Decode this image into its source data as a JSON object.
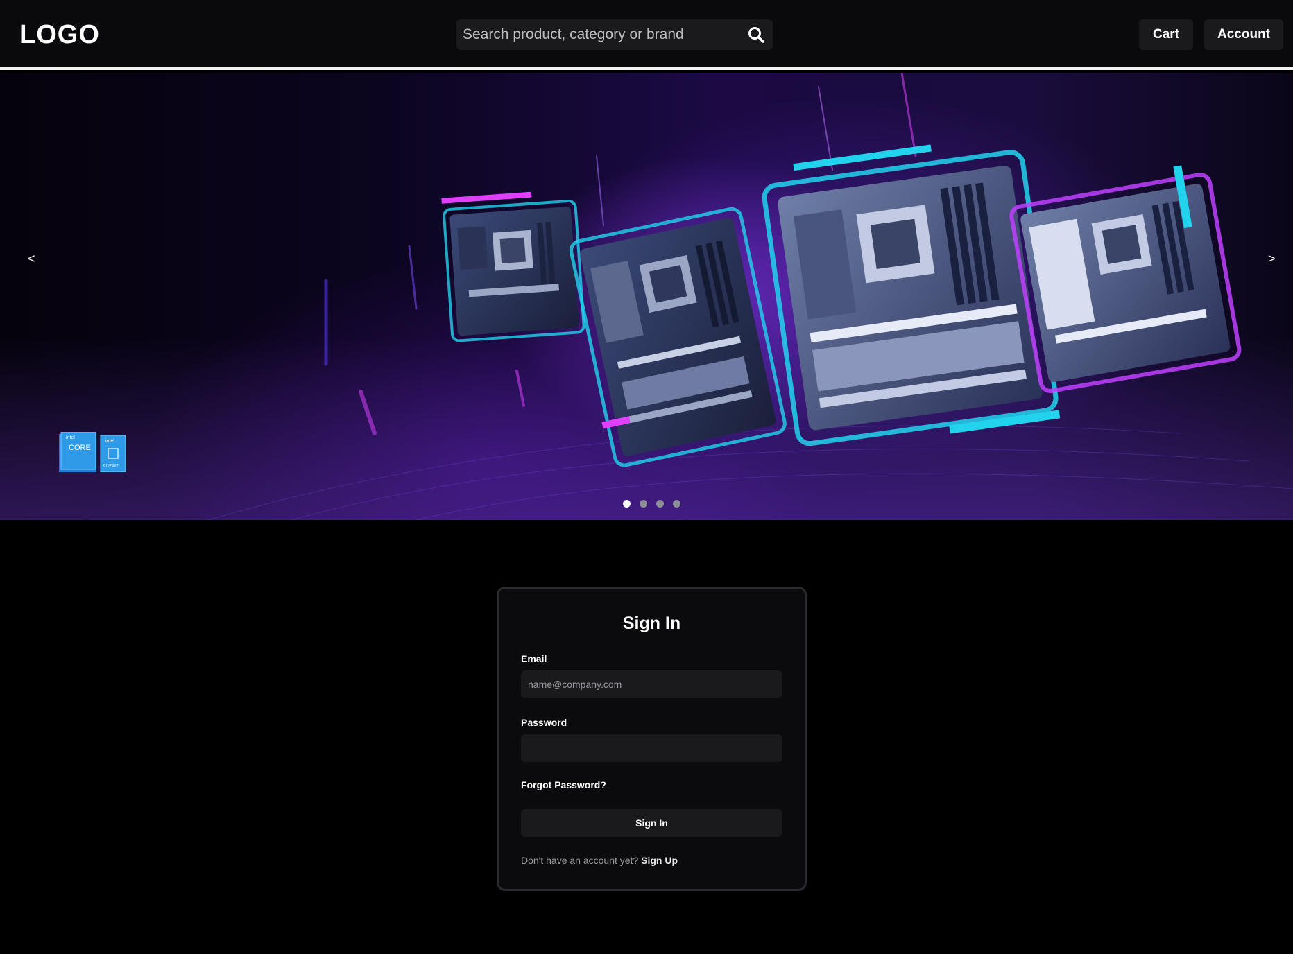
{
  "header": {
    "logo": "LOGO",
    "search_placeholder": "Search product, category or brand",
    "cart_label": "Cart",
    "account_label": "Account"
  },
  "hero": {
    "prev_label": "<",
    "next_label": ">",
    "slide_count": 4,
    "active_slide": 1,
    "badge_text": [
      "intel",
      "CORE",
      "intel",
      "CHIPSET"
    ]
  },
  "signin": {
    "title": "Sign In",
    "email_label": "Email",
    "email_placeholder": "name@company.com",
    "password_label": "Password",
    "forgot_label": "Forgot Password?",
    "submit_label": "Sign In",
    "signup_prompt": "Don't have an account yet?",
    "signup_link": "Sign Up"
  },
  "colors": {
    "background": "#000000",
    "header_bg": "#0a0a0c",
    "control_bg": "#1a1a1d",
    "hero_purple": "#8a2be2",
    "hero_cyan": "#22d3ee"
  }
}
